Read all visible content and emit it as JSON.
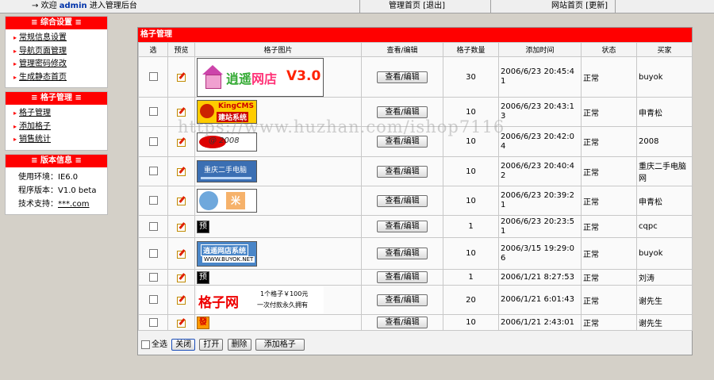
{
  "topbar": {
    "arrow": "→",
    "welcome": "欢迎",
    "user": "admin",
    "enter": "进入管理后台",
    "admin_home": "管理首页",
    "logout": "[退出]",
    "site_home": "网站首页",
    "update": "[更新]"
  },
  "sidebar": {
    "section1": {
      "title": "≡ 综合设置 ≡",
      "items": [
        "常规信息设置",
        "导航页面管理",
        "管理密码修改",
        "生成静态首页"
      ]
    },
    "section2": {
      "title": "≡ 格子管理 ≡",
      "items": [
        "格子管理",
        "添加格子",
        "销售统计"
      ]
    },
    "section3": {
      "title": "≡ 版本信息 ≡",
      "env_label": "使用环境：",
      "env_value": "IE6.0",
      "ver_label": "程序版本：",
      "ver_value": "V1.0 beta",
      "support_label": "技术支持：",
      "support_value": "***.com"
    }
  },
  "main": {
    "title": "格子管理",
    "columns": [
      "选",
      "预览",
      "格子图片",
      "查看/编辑",
      "格子数量",
      "添加时间",
      "状态",
      "买家"
    ],
    "edit_label": "查看/编辑",
    "rows": [
      {
        "qty": "30",
        "time": "2006/6/23 20:45:41",
        "status": "正常",
        "buyer": "buyok"
      },
      {
        "qty": "10",
        "time": "2006/6/23 20:43:13",
        "status": "正常",
        "buyer": "申青松"
      },
      {
        "qty": "10",
        "time": "2006/6/23 20:42:04",
        "status": "正常",
        "buyer": "2008"
      },
      {
        "qty": "10",
        "time": "2006/6/23 20:40:42",
        "status": "正常",
        "buyer": "重庆二手电脑网"
      },
      {
        "qty": "10",
        "time": "2006/6/23 20:39:21",
        "status": "正常",
        "buyer": "申青松"
      },
      {
        "qty": "1",
        "time": "2006/6/23 20:23:51",
        "status": "正常",
        "buyer": "cqpc"
      },
      {
        "qty": "10",
        "time": "2006/3/15 19:29:06",
        "status": "正常",
        "buyer": "buyok"
      },
      {
        "qty": "1",
        "time": "2006/1/21 8:27:53",
        "status": "正常",
        "buyer": "刘涛"
      },
      {
        "qty": "20",
        "time": "2006/1/21 6:01:43",
        "status": "正常",
        "buyer": "谢先生"
      },
      {
        "qty": "10",
        "time": "2006/1/21 2:43:01",
        "status": "正常",
        "buyer": "谢先生"
      }
    ],
    "banners": {
      "b1_cn_a": "逍遥",
      "b1_cn_b": "网店",
      "b1_ver": "V3.0",
      "b2_l1": "KingCMS",
      "b2_l2": "建站系统",
      "b3_tx": "@ 2008",
      "b4_tx": "重庆二手电脑",
      "b5_m": "米",
      "b6_tx": "逍遥网店系统",
      "b6_sub": "WWW.BUYOK.NET",
      "b7_big": "格子网",
      "b7_sm1": "1个格子￥100元",
      "b7_sm2": "一次付款永久拥有",
      "yu": "预",
      "fa": "發"
    },
    "footer": {
      "select_all": "全选",
      "close": "关闭",
      "open": "打开",
      "delete": "删除",
      "add": "添加格子"
    }
  },
  "watermark": "https://www.huzhan.com/ishop7116"
}
